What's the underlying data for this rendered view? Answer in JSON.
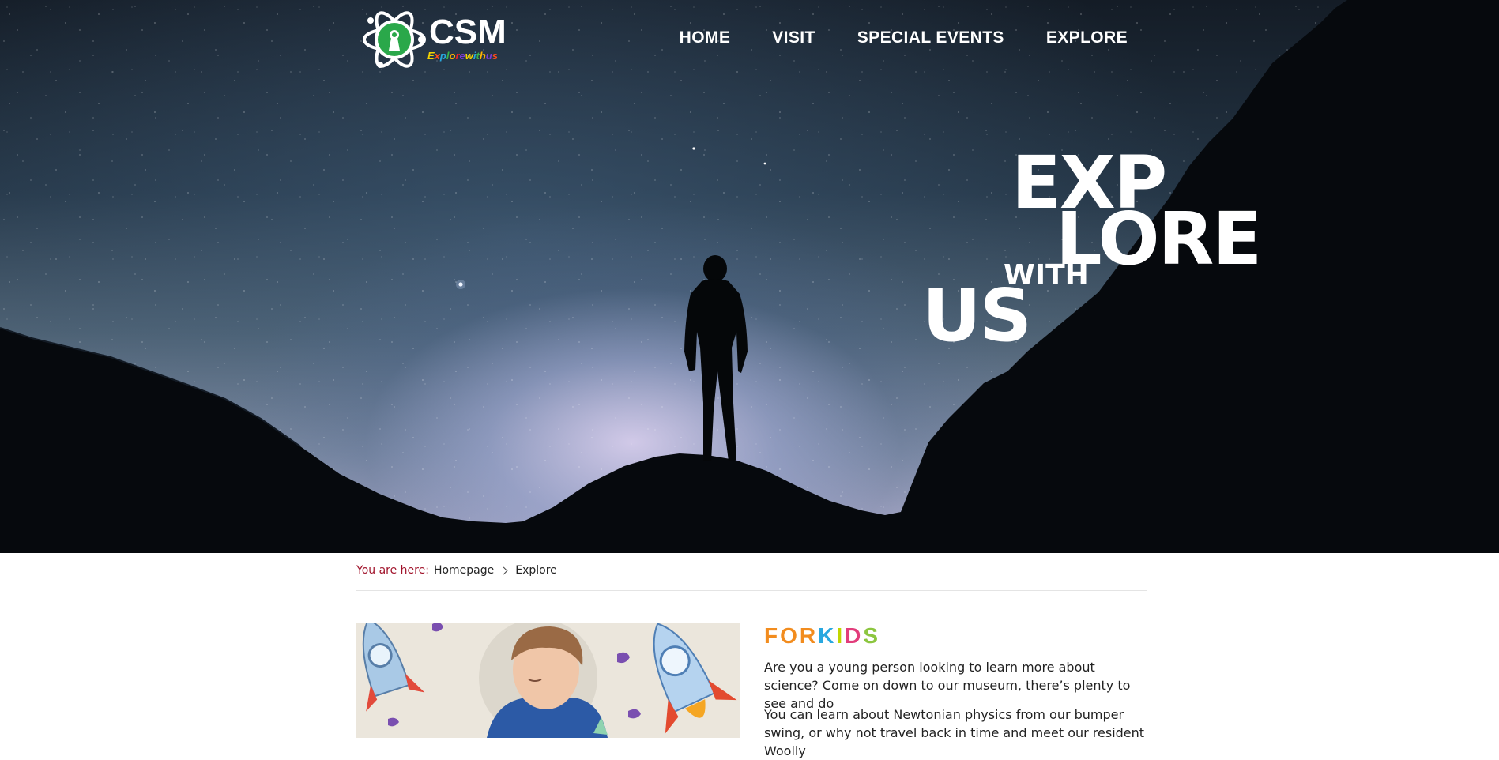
{
  "logo": {
    "name": "CSM",
    "tagline": "Explore with us",
    "tagline_colors": [
      "#f5d400",
      "#ff4a1a",
      "#28a9e0",
      "#39b54a",
      "#ffb400",
      "#e8212a",
      "#7a3bd1",
      "#ffffff",
      "#f5d400",
      "#28a9e0",
      "#39b54a",
      "#ffb400",
      "#e8212a",
      "#7a3bd1",
      "#ff4a1a"
    ]
  },
  "nav": {
    "items": [
      {
        "label": "HOME"
      },
      {
        "label": "VISIT"
      },
      {
        "label": "SPECIAL EVENTS"
      },
      {
        "label": "EXPLORE"
      }
    ]
  },
  "hero": {
    "line1": "EXP",
    "line2": "LORE",
    "line3": "WITH",
    "line4": "US"
  },
  "breadcrumb": {
    "label": "You are here:",
    "items": [
      "Homepage",
      "Explore"
    ]
  },
  "kids": {
    "title": "FOR KIDS",
    "title_colors": [
      "#f28c1e",
      "#f28c1e",
      "#f28c1e",
      "#ffffff",
      "#29a8e0",
      "#c2d600",
      "#e23d7b",
      "#8cc63f"
    ],
    "paragraph1": "Are you a young person looking to learn more about science? Come on down to our museum, there’s plenty to see and do",
    "paragraph2": "You can learn about Newtonian physics from our bumper swing, or why not travel back in time and meet our resident Woolly"
  },
  "colors": {
    "breadcrumb_label": "#a0122a",
    "logo_green": "#2aa84a"
  }
}
